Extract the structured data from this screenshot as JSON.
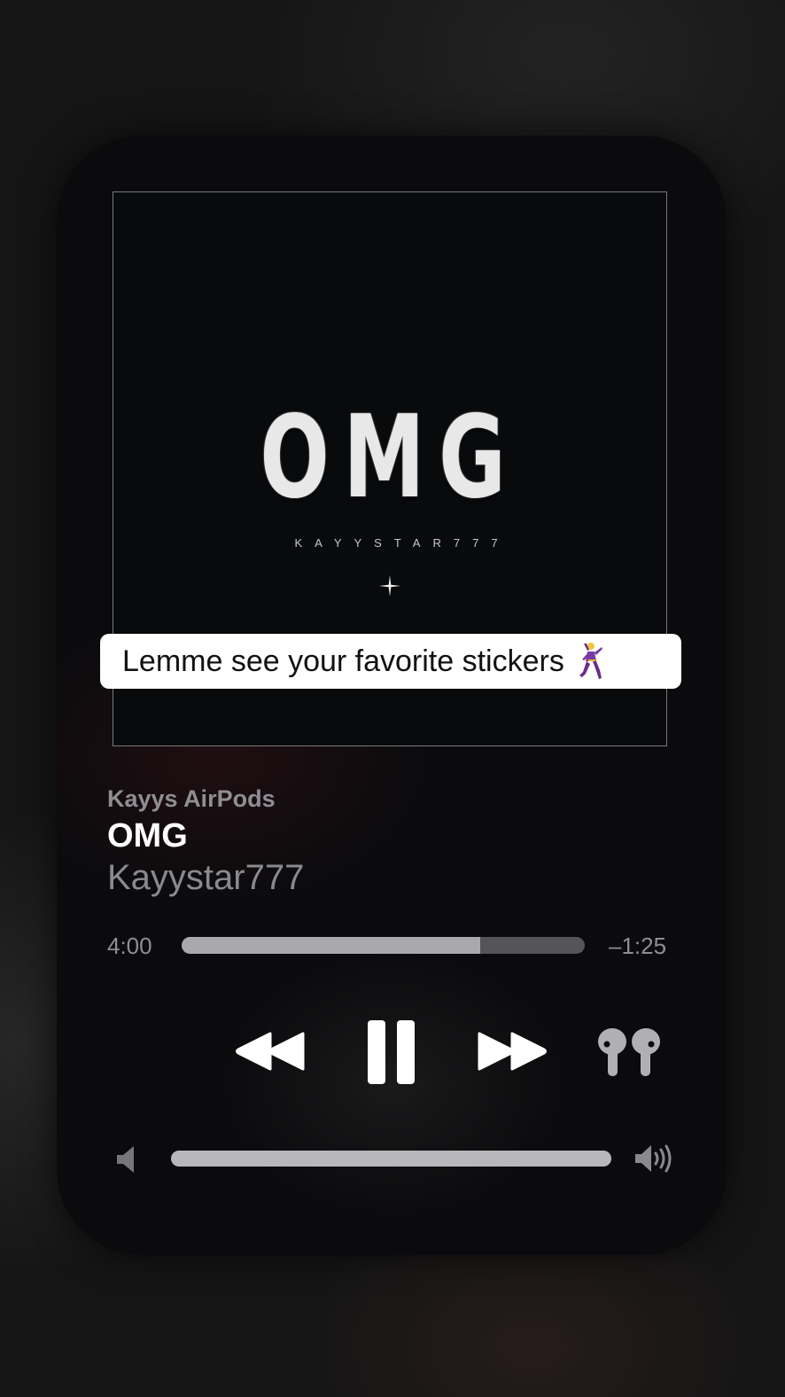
{
  "artwork": {
    "title": "OMG",
    "subtitle": "KAYYSTAR777"
  },
  "caption": {
    "text": "Lemme see your favorite stickers",
    "emoji_icon": "dancing-person-icon"
  },
  "now_playing": {
    "device": "Kayys AirPods",
    "title": "OMG",
    "artist": "Kayystar777"
  },
  "progress": {
    "elapsed": "4:00",
    "remaining": "–1:25",
    "fraction": 0.74
  },
  "controls": {
    "rewind_icon": "rewind-icon",
    "pause_icon": "pause-icon",
    "forward_icon": "fast-forward-icon",
    "output_icon": "airpods-icon"
  },
  "volume": {
    "fraction": 1.0,
    "low_icon": "volume-low-icon",
    "high_icon": "volume-high-icon"
  },
  "colors": {
    "accent": "#ffffff",
    "track": "#555558",
    "fill": "#a9a9ac"
  }
}
